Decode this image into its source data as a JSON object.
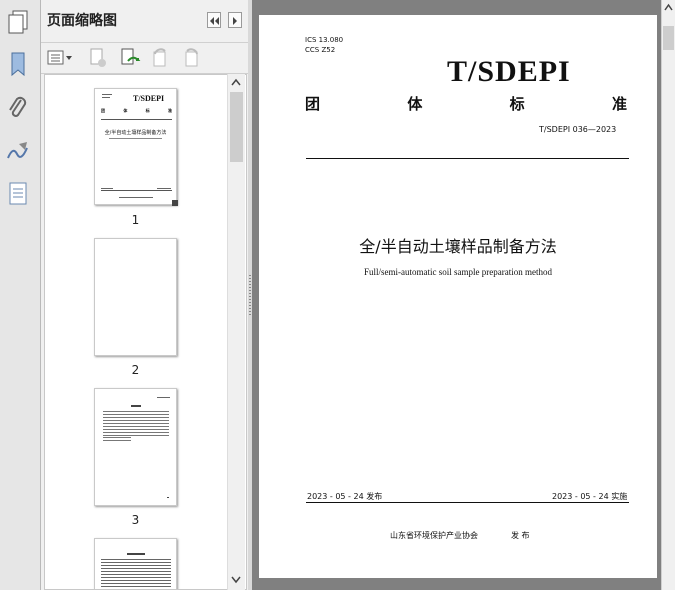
{
  "sidebar": {
    "title": "页面缩略图",
    "tools": [
      {
        "icon": "bookmark-icon"
      },
      {
        "icon": "paperclip-icon"
      },
      {
        "icon": "signature-icon"
      },
      {
        "icon": "page-layers-icon"
      }
    ]
  },
  "thumbnails": [
    {
      "label": "1"
    },
    {
      "label": "2"
    },
    {
      "label": "3"
    },
    {
      "label": ""
    }
  ],
  "thumb_page1": {
    "brand": "T/SDEPI",
    "title": "全/半自动土壤样品制备方法"
  },
  "document": {
    "ics": "ICS  13.080",
    "ccs": "CCS Z52",
    "brand": "T/SDEPI",
    "standard_chars": [
      "团",
      "体",
      "标",
      "准"
    ],
    "code": "T/SDEPI 036—2023",
    "title_cn": "全/半自动土壤样品制备方法",
    "title_en": "Full/semi-automatic soil sample preparation method",
    "publish_date": "2023 - 05 - 24 发布",
    "effective_date": "2023 - 05 - 24 实施",
    "publisher": "山东省环境保护产业协会",
    "publish_word": "发  布"
  }
}
